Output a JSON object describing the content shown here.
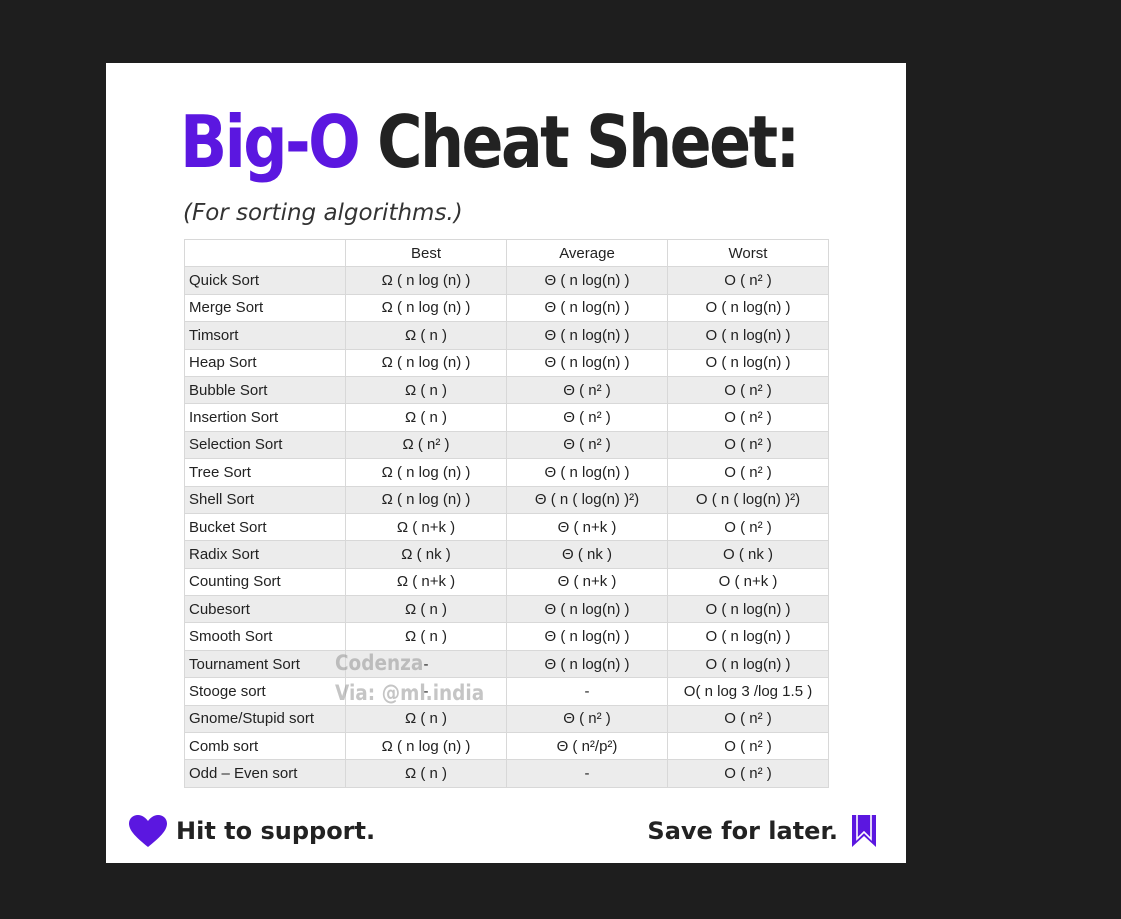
{
  "title": {
    "accent": "Big-O",
    "rest": "Cheat Sheet:"
  },
  "subtitle": "(For sorting algorithms.)",
  "table": {
    "headers": [
      "",
      "Best",
      "Average",
      "Worst"
    ],
    "rows": [
      [
        "Quick Sort",
        "Ω ( n log (n) )",
        "Θ ( n log(n) )",
        "O ( n² )"
      ],
      [
        "Merge Sort",
        "Ω ( n log (n) )",
        "Θ ( n log(n) )",
        "O ( n log(n) )"
      ],
      [
        "Timsort",
        "Ω ( n )",
        "Θ ( n log(n) )",
        "O ( n log(n) )"
      ],
      [
        "Heap Sort",
        "Ω ( n log (n) )",
        "Θ ( n log(n) )",
        "O ( n log(n) )"
      ],
      [
        "Bubble Sort",
        "Ω ( n )",
        "Θ ( n² )",
        "O ( n² )"
      ],
      [
        "Insertion Sort",
        "Ω ( n )",
        "Θ ( n² )",
        "O ( n² )"
      ],
      [
        "Selection Sort",
        "Ω ( n² )",
        "Θ ( n² )",
        "O ( n² )"
      ],
      [
        "Tree Sort",
        "Ω ( n log (n) )",
        "Θ ( n log(n) )",
        "O ( n² )"
      ],
      [
        "Shell Sort",
        "Ω ( n log (n) )",
        "Θ ( n ( log(n) )²)",
        "O ( n ( log(n) )²)"
      ],
      [
        "Bucket Sort",
        "Ω ( n+k )",
        "Θ ( n+k )",
        "O ( n² )"
      ],
      [
        "Radix Sort",
        "Ω ( nk )",
        "Θ ( nk )",
        "O ( nk )"
      ],
      [
        "Counting Sort",
        "Ω ( n+k )",
        "Θ ( n+k )",
        "O ( n+k )"
      ],
      [
        "Cubesort",
        "Ω ( n )",
        "Θ ( n log(n) )",
        "O ( n log(n) )"
      ],
      [
        "Smooth Sort",
        "Ω ( n )",
        "Θ ( n log(n) )",
        "O ( n log(n) )"
      ],
      [
        "Tournament Sort",
        "-",
        "Θ ( n log(n) )",
        "O ( n log(n) )"
      ],
      [
        "Stooge sort",
        "-",
        "-",
        "O( n log 3 /log 1.5 )"
      ],
      [
        "Gnome/Stupid sort",
        "Ω ( n )",
        "Θ ( n² )",
        "O ( n² )"
      ],
      [
        "Comb sort",
        "Ω ( n log (n) )",
        "Θ ( n²/p²)",
        "O ( n² )"
      ],
      [
        "Odd – Even sort",
        "Ω ( n )",
        "-",
        "O ( n² )"
      ]
    ]
  },
  "watermark": {
    "line1": "Codenza",
    "line2": "Via: @ml.india"
  },
  "footer": {
    "left_text": "Hit to support.",
    "right_text": "Save for later.",
    "left_icon": "heart-icon",
    "right_icon": "bookmark-icon"
  },
  "colors": {
    "accent": "#5b17e0",
    "text": "#222222",
    "background": "#1e1e1e",
    "card": "#ffffff",
    "row_alt": "#ececec"
  }
}
